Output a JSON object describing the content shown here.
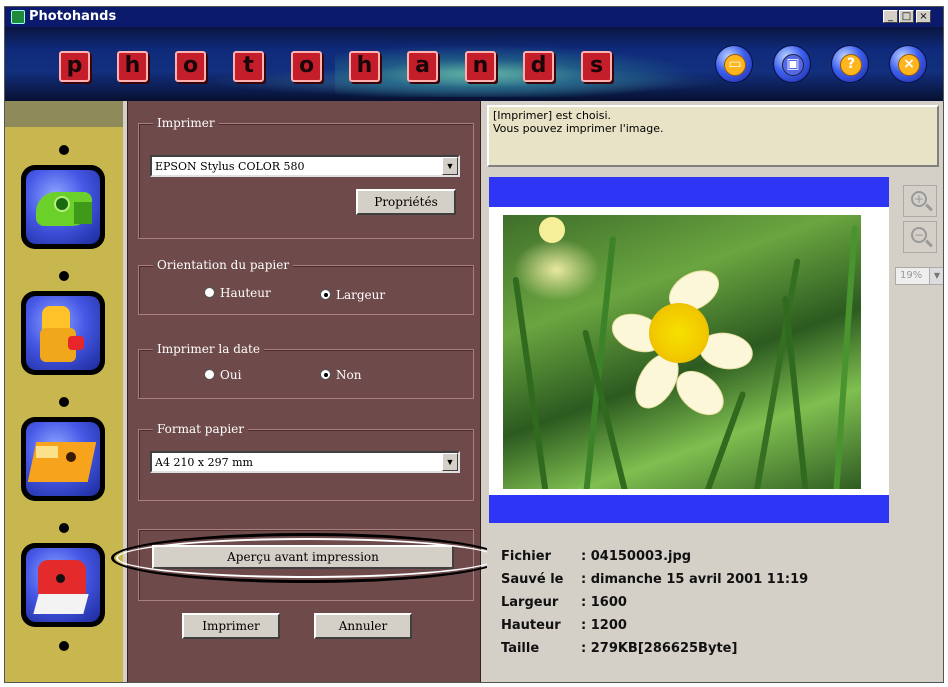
{
  "window": {
    "title": "Photohands",
    "min": "_",
    "max": "□",
    "close": "×"
  },
  "banner": {
    "logo_letters": [
      "p",
      "h",
      "o",
      "t",
      "o",
      "h",
      "a",
      "n",
      "d",
      "s"
    ],
    "buttons": [
      {
        "name": "open-folder-icon",
        "glyph": "▭"
      },
      {
        "name": "save-disk-icon",
        "glyph": "▣"
      },
      {
        "name": "help-icon",
        "glyph": "?"
      },
      {
        "name": "close-icon",
        "glyph": "×"
      }
    ]
  },
  "printer_group": {
    "label": "Imprimer",
    "selected_printer": "EPSON Stylus COLOR 580",
    "properties_button": "Propriétés"
  },
  "orientation_group": {
    "label": "Orientation du papier",
    "options": [
      {
        "label": "Hauteur",
        "selected": false
      },
      {
        "label": "Largeur",
        "selected": true
      }
    ]
  },
  "date_group": {
    "label": "Imprimer la date",
    "options": [
      {
        "label": "Oui",
        "selected": false
      },
      {
        "label": "Non",
        "selected": true
      }
    ]
  },
  "paper_group": {
    "label": "Format papier",
    "selected_format": "A4 210 x 297 mm"
  },
  "buttons": {
    "preview": "Aperçu avant impression",
    "print": "Imprimer",
    "cancel": "Annuler"
  },
  "status": {
    "line1": "[Imprimer] est choisi.",
    "line2": "Vous pouvez imprimer l'image."
  },
  "zoom": {
    "level": "19%"
  },
  "file_info": [
    {
      "key": "Fichier",
      "value": ": 04150003.jpg"
    },
    {
      "key": "Sauvé le",
      "value": ": dimanche 15 avril 2001 11:19"
    },
    {
      "key": "Largeur",
      "value": ": 1600"
    },
    {
      "key": "Hauteur",
      "value": ": 1200"
    },
    {
      "key": "Taille",
      "value": ": 279KB[286625Byte]"
    }
  ],
  "colors": {
    "banner": "#0f2a7a",
    "rail": "#c8b64e",
    "panel": "#6f4a4a",
    "preview_border": "#2f35f5"
  }
}
